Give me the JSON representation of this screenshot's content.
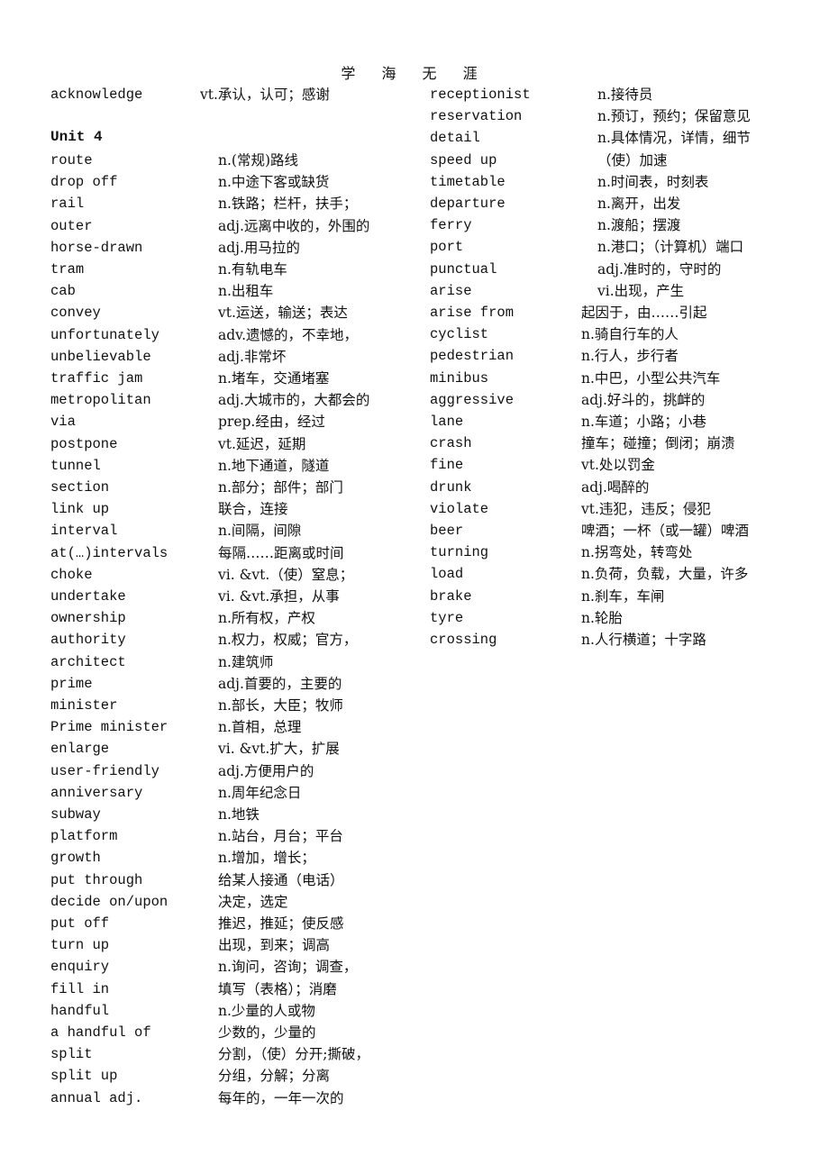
{
  "header": "学 海 无 涯",
  "unit_heading": "Unit 4",
  "intro": {
    "word": "acknowledge",
    "def": "vt.承认，认可；感谢"
  },
  "left": [
    {
      "word": "route",
      "def": "n.(常规)路线"
    },
    {
      "word": "drop off",
      "def": "n.中途下客或缺货"
    },
    {
      "word": "rail",
      "def": "n.铁路；栏杆，扶手；"
    },
    {
      "word": "outer",
      "def": "adj.远离中收的，外围的"
    },
    {
      "word": "horse-drawn",
      "def": "adj.用马拉的"
    },
    {
      "word": "tram",
      "def": "n.有轨电车"
    },
    {
      "word": "cab",
      "def": "n.出租车"
    },
    {
      "word": "convey",
      "def": "vt.运送，输送；表达"
    },
    {
      "word": "unfortunately",
      "def": "adv.遗憾的，不幸地，"
    },
    {
      "word": "unbelievable",
      "def": "adj.非常坏"
    },
    {
      "word": "traffic jam",
      "def": "n.堵车，交通堵塞"
    },
    {
      "word": "metropolitan",
      "def": "adj.大城市的，大都会的"
    },
    {
      "word": "via",
      "def": "prep.经由，经过"
    },
    {
      "word": "postpone",
      "def": "vt.延迟，延期"
    },
    {
      "word": "tunnel",
      "def": "n.地下通道，隧道"
    },
    {
      "word": "section",
      "def": "n.部分；部件；部门"
    },
    {
      "word": "link up",
      "def": "联合，连接"
    },
    {
      "word": "interval",
      "def": "n.间隔，间隙"
    },
    {
      "word": "at(…)intervals",
      "def": "每隔……距离或时间"
    },
    {
      "word": "choke",
      "def": "vi. &vt.（使）窒息；"
    },
    {
      "word": "undertake",
      "def": "vi. &vt.承担，从事"
    },
    {
      "word": "ownership",
      "def": "n.所有权，产权"
    },
    {
      "word": "authority",
      "def": "n.权力，权威；官方，"
    },
    {
      "word": "architect",
      "def": "n.建筑师"
    },
    {
      "word": "prime",
      "def": "adj.首要的，主要的"
    },
    {
      "word": "minister",
      "def": "n.部长，大臣；牧师"
    },
    {
      "word": "Prime minister",
      "def": "n.首相，总理"
    },
    {
      "word": "enlarge",
      "def": "vi. &vt.扩大，扩展"
    },
    {
      "word": "user-friendly",
      "def": "adj.方便用户的"
    },
    {
      "word": "anniversary",
      "def": "n.周年纪念日"
    },
    {
      "word": "subway",
      "def": "n.地铁"
    },
    {
      "word": "platform",
      "def": "n.站台，月台；平台"
    },
    {
      "word": "growth",
      "def": "n.增加，增长；"
    },
    {
      "word": "put through",
      "def": "给某人接通（电话）"
    },
    {
      "word": "decide on/upon",
      "def": "决定，选定"
    },
    {
      "word": "put off",
      "def": "推迟，推延；使反感"
    },
    {
      "word": "turn up",
      "def": "出现，到来；调高"
    },
    {
      "word": "enquiry",
      "def": "n.询问，咨询；调查，"
    },
    {
      "word": "fill in",
      "def": "填写（表格）；消磨"
    },
    {
      "word": "handful",
      "def": "n.少量的人或物"
    },
    {
      "word": "a handful of",
      "def": "少数的，少量的"
    },
    {
      "word": "split",
      "def": "分割，（使）分开;撕破，"
    },
    {
      "word": "split up",
      "def": "分组，分解；分离"
    },
    {
      "word": "annual  adj.",
      "def": "每年的，一年一次的"
    }
  ],
  "right": [
    {
      "word": "receptionist",
      "def": "n.接待员"
    },
    {
      "word": "reservation",
      "def": "n.预订，预约；保留意见"
    },
    {
      "word": "detail",
      "def": "n.具体情况，详情，细节"
    },
    {
      "word": "speed up",
      "def": "（使）加速"
    },
    {
      "word": "timetable",
      "def": "n.时间表，时刻表"
    },
    {
      "word": "departure",
      "def": "n.离开，出发"
    },
    {
      "word": "ferry",
      "def": "n.渡船；摆渡"
    },
    {
      "word": "port",
      "def": "n.港口；（计算机）端口"
    },
    {
      "word": "punctual",
      "def": "adj.准时的，守时的"
    },
    {
      "word": "arise",
      "def": "vi.出现，产生"
    },
    {
      "word": "arise from",
      "def": "起因于，由……引起"
    },
    {
      "word": "cyclist",
      "def": "n.骑自行车的人"
    },
    {
      "word": "pedestrian",
      "def": "n.行人，步行者"
    },
    {
      "word": "minibus",
      "def": "n.中巴，小型公共汽车"
    },
    {
      "word": "aggressive",
      "def": "adj.好斗的，挑衅的"
    },
    {
      "word": "lane",
      "def": "n.车道；小路；小巷"
    },
    {
      "word": "crash",
      "def": "撞车；碰撞；倒闭；崩溃"
    },
    {
      "word": "fine",
      "def": "vt.处以罚金"
    },
    {
      "word": "drunk",
      "def": "adj.喝醉的"
    },
    {
      "word": "violate",
      "def": "vt.违犯，违反；侵犯"
    },
    {
      "word": "beer",
      "def": "啤酒；一杯（或一罐）啤酒"
    },
    {
      "word": "turning",
      "def": "n.拐弯处，转弯处"
    },
    {
      "word": "load",
      "def": "n.负荷，负载，大量，许多"
    },
    {
      "word": "brake",
      "def": "n.刹车，车闸"
    },
    {
      "word": "tyre",
      "def": "n.轮胎"
    },
    {
      "word": "crossing",
      "def": "n.人行横道；十字路"
    }
  ]
}
